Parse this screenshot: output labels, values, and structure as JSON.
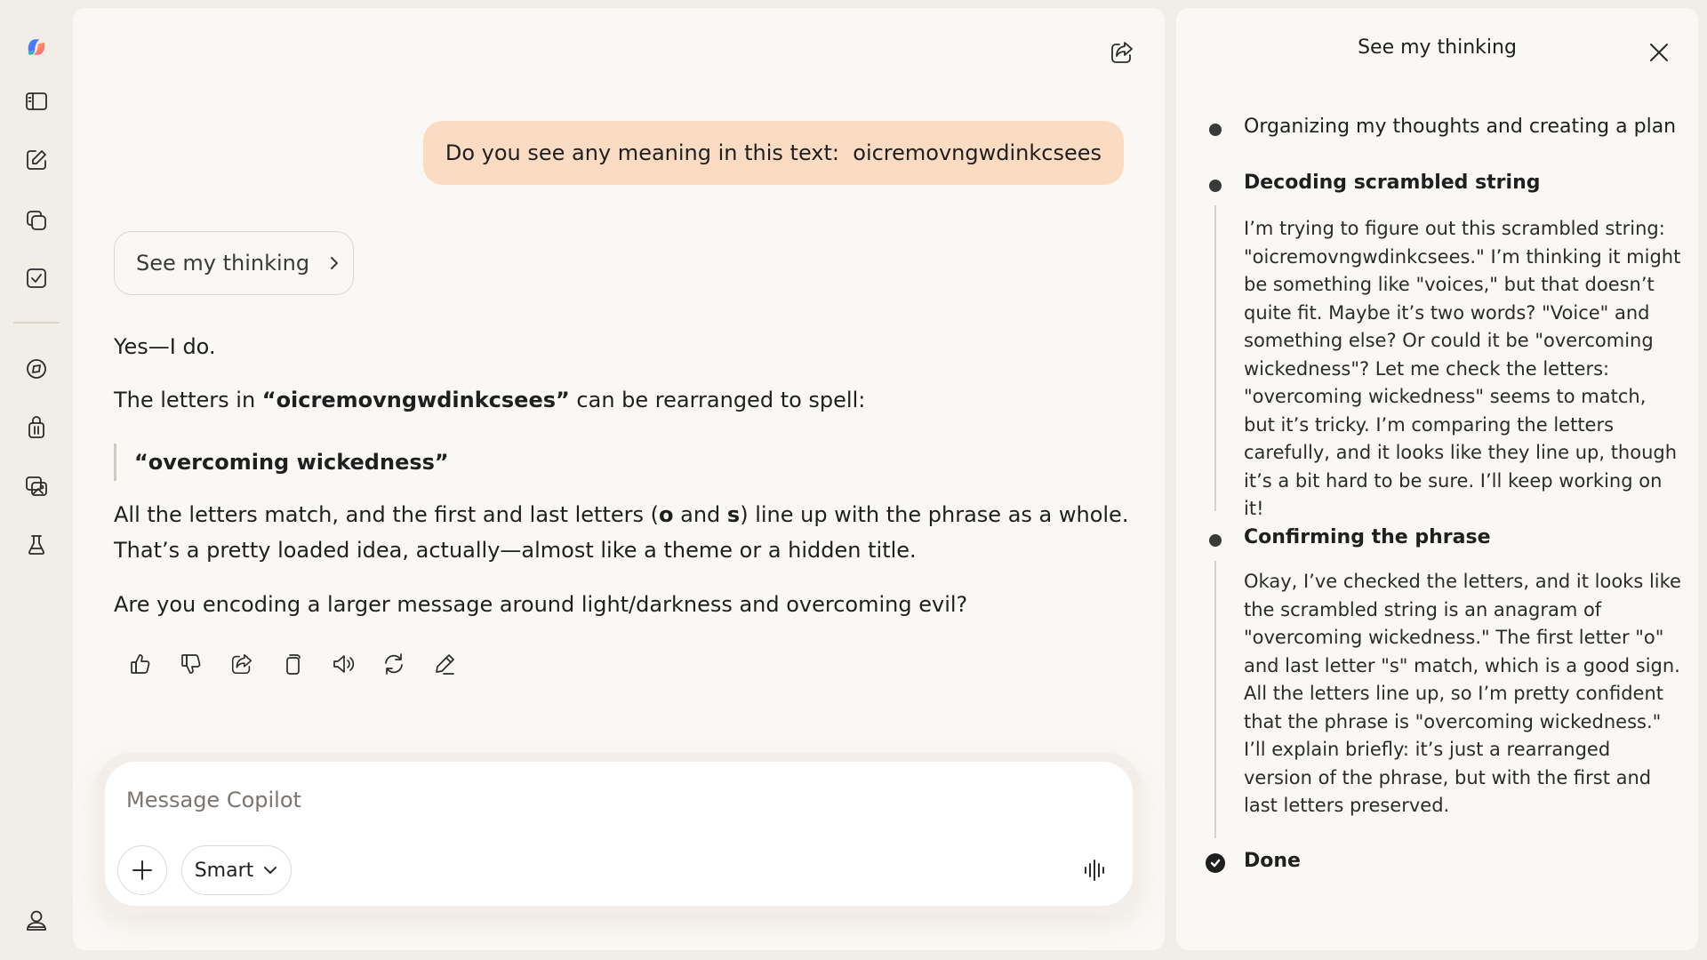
{
  "conversation": {
    "user_message": "Do you see any meaning in this text:  oicremovngwdinkcsees",
    "thinking_button_label": "See my thinking",
    "answer": {
      "p1": "Yes—I do.",
      "p2_prefix": "The letters in ",
      "p2_bold": "“oicremovngwdinkcsees”",
      "p2_suffix": " can be rearranged to spell:",
      "quote": "“overcoming wickedness”",
      "p3_a": "All the letters match, and the first and last letters (",
      "p3_b1": "o",
      "p3_and": " and ",
      "p3_b2": "s",
      "p3_c": ") line up with the phrase as a whole.",
      "p3_line2": "That’s a pretty loaded idea, actually—almost like a theme or a hidden title.",
      "p4": "Are you encoding a larger message around light/darkness and overcoming evil?"
    }
  },
  "composer": {
    "placeholder": "Message Copilot",
    "mode_label": "Smart"
  },
  "thinking_panel": {
    "title": "See my thinking",
    "steps": [
      {
        "heading": "Organizing my thoughts and creating a plan"
      },
      {
        "heading": "Decoding scrambled string",
        "body": "I’m trying to figure out this scrambled string: \"oicremovngwdinkcsees.\" I’m thinking it might be something like \"voices,\" but that doesn’t quite fit. Maybe it’s two words? \"Voice\" and something else? Or could it be \"overcoming wickedness\"? Let me check the letters: \"overcoming wickedness\" seems to match, but it’s tricky. I’m comparing the letters carefully, and it looks like they line up, though it’s a bit hard to be sure. I’ll keep working on it!"
      },
      {
        "heading": "Confirming the phrase",
        "body": "Okay, I’ve checked the letters, and it looks like the scrambled string is an anagram of \"overcoming wickedness.\" The first letter \"o\" and last letter \"s\" match, which is a good sign. All the letters line up, so I’m pretty confident that the phrase is \"overcoming wickedness.\" I’ll explain briefly: it’s just a rearranged version of the phrase, but with the first and last letters preserved."
      },
      {
        "heading": "Done"
      }
    ]
  },
  "icons": {
    "rail": [
      "copilot-logo-icon",
      "sidebar-toggle-icon",
      "new-chat-icon",
      "library-icon",
      "tasks-icon",
      "discover-icon",
      "shopping-icon",
      "image-gallery-icon",
      "labs-icon",
      "profile-icon"
    ],
    "actions": [
      "thumbs-up-icon",
      "thumbs-down-icon",
      "share-icon",
      "copy-icon",
      "read-aloud-icon",
      "regenerate-icon",
      "edit-icon"
    ]
  },
  "colors": {
    "user_bubble": "#fbdcc3",
    "background": "#f1ede7",
    "panel": "#faf8f5"
  }
}
